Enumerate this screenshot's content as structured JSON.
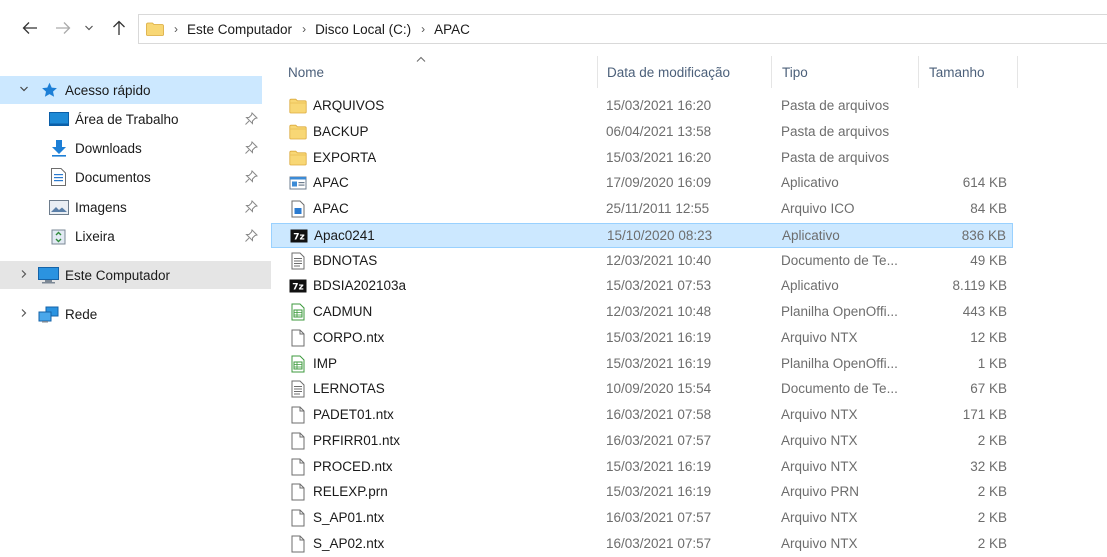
{
  "address": {
    "crumbs": [
      "Este Computador",
      "Disco Local (C:)",
      "APAC"
    ]
  },
  "sidebar": {
    "quick_access": "Acesso rápido",
    "pinned": [
      {
        "label": "Área de Trabalho",
        "icon": "desktop-icon"
      },
      {
        "label": "Downloads",
        "icon": "download-icon"
      },
      {
        "label": "Documentos",
        "icon": "documents-icon"
      },
      {
        "label": "Imagens",
        "icon": "pictures-icon"
      },
      {
        "label": "Lixeira",
        "icon": "recycle-bin-icon"
      }
    ],
    "this_pc": "Este Computador",
    "network": "Rede"
  },
  "columns": {
    "name": "Nome",
    "date": "Data de modificação",
    "type": "Tipo",
    "size": "Tamanho"
  },
  "files": [
    {
      "name": "ARQUIVOS",
      "date": "15/03/2021 16:20",
      "type": "Pasta de arquivos",
      "size": "",
      "icon": "folder"
    },
    {
      "name": "BACKUP",
      "date": "06/04/2021 13:58",
      "type": "Pasta de arquivos",
      "size": "",
      "icon": "folder"
    },
    {
      "name": "EXPORTA",
      "date": "15/03/2021 16:20",
      "type": "Pasta de arquivos",
      "size": "",
      "icon": "folder"
    },
    {
      "name": "APAC",
      "date": "17/09/2020 16:09",
      "type": "Aplicativo",
      "size": "614 KB",
      "icon": "app"
    },
    {
      "name": "APAC",
      "date": "25/11/2011 12:55",
      "type": "Arquivo ICO",
      "size": "84 KB",
      "icon": "ico"
    },
    {
      "name": "Apac0241",
      "date": "15/10/2020 08:23",
      "type": "Aplicativo",
      "size": "836 KB",
      "icon": "7z"
    },
    {
      "name": "BDNOTAS",
      "date": "12/03/2021 10:40",
      "type": "Documento de Te...",
      "size": "49 KB",
      "icon": "text"
    },
    {
      "name": "BDSIA202103a",
      "date": "15/03/2021 07:53",
      "type": "Aplicativo",
      "size": "8.119 KB",
      "icon": "7z"
    },
    {
      "name": "CADMUN",
      "date": "12/03/2021 10:48",
      "type": "Planilha OpenOffi...",
      "size": "443 KB",
      "icon": "sheet"
    },
    {
      "name": "CORPO.ntx",
      "date": "15/03/2021 16:19",
      "type": "Arquivo NTX",
      "size": "12 KB",
      "icon": "file"
    },
    {
      "name": "IMP",
      "date": "15/03/2021 16:19",
      "type": "Planilha OpenOffi...",
      "size": "1 KB",
      "icon": "sheet"
    },
    {
      "name": "LERNOTAS",
      "date": "10/09/2020 15:54",
      "type": "Documento de Te...",
      "size": "67 KB",
      "icon": "text"
    },
    {
      "name": "PADET01.ntx",
      "date": "16/03/2021 07:58",
      "type": "Arquivo NTX",
      "size": "171 KB",
      "icon": "file"
    },
    {
      "name": "PRFIRR01.ntx",
      "date": "16/03/2021 07:57",
      "type": "Arquivo NTX",
      "size": "2 KB",
      "icon": "file"
    },
    {
      "name": "PROCED.ntx",
      "date": "15/03/2021 16:19",
      "type": "Arquivo NTX",
      "size": "32 KB",
      "icon": "file"
    },
    {
      "name": "RELEXP.prn",
      "date": "15/03/2021 16:19",
      "type": "Arquivo PRN",
      "size": "2 KB",
      "icon": "file"
    },
    {
      "name": "S_AP01.ntx",
      "date": "16/03/2021 07:57",
      "type": "Arquivo NTX",
      "size": "2 KB",
      "icon": "file"
    },
    {
      "name": "S_AP02.ntx",
      "date": "16/03/2021 07:57",
      "type": "Arquivo NTX",
      "size": "2 KB",
      "icon": "file"
    }
  ],
  "selected_index": 5,
  "colors": {
    "selection": "#cce8ff",
    "selection_border": "#99d1ff",
    "hover": "#e5e5e5",
    "folder": "#f8d775",
    "accent": "#0078d7"
  }
}
